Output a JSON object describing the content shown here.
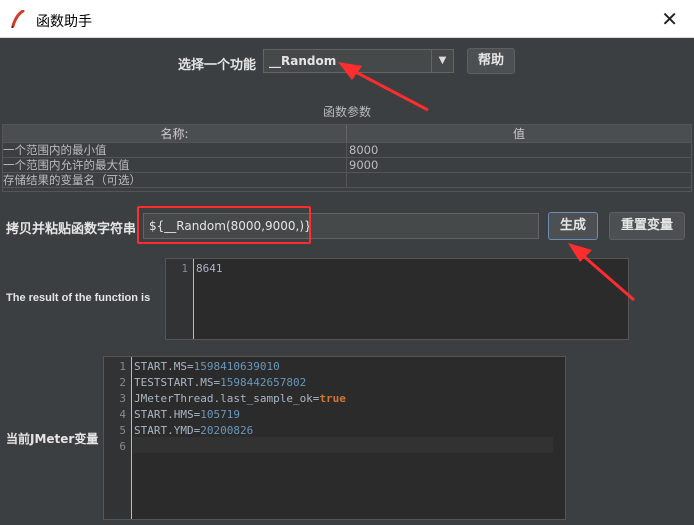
{
  "window": {
    "title": "函数助手",
    "close_icon": "close-icon"
  },
  "selector": {
    "label": "选择一个功能",
    "value": "__Random",
    "help_label": "帮助"
  },
  "params": {
    "section_title": "函数参数",
    "col_name": "名称:",
    "col_value": "值",
    "rows": [
      {
        "name": "一个范围内的最小值",
        "value": "8000"
      },
      {
        "name": "一个范围内允许的最大值",
        "value": "9000"
      },
      {
        "name": "存储结果的变量名（可选）",
        "value": ""
      }
    ]
  },
  "copy": {
    "label": "拷贝并粘贴函数字符串",
    "value": "${__Random(8000,9000,)}",
    "generate_label": "生成",
    "reset_label": "重置变量"
  },
  "result": {
    "label": "The result of the function is",
    "lines": [
      {
        "n": "1",
        "text": "8641"
      }
    ]
  },
  "vars": {
    "label": "当前JMeter变量",
    "lines": [
      {
        "n": "1",
        "key": "START.MS=",
        "val": "1598410639010"
      },
      {
        "n": "2",
        "key": "TESTSTART.MS=",
        "val": "1598442657802"
      },
      {
        "n": "3",
        "key": "JMeterThread.last_sample_ok=",
        "val": "true"
      },
      {
        "n": "4",
        "key": "START.HMS=",
        "val": "105719"
      },
      {
        "n": "5",
        "key": "START.YMD=",
        "val": "20200826"
      },
      {
        "n": "6",
        "key": "",
        "val": ""
      }
    ]
  },
  "colors": {
    "annotation": "#ff2d2d",
    "number": "#6897bb",
    "keyword": "#cc7832"
  }
}
